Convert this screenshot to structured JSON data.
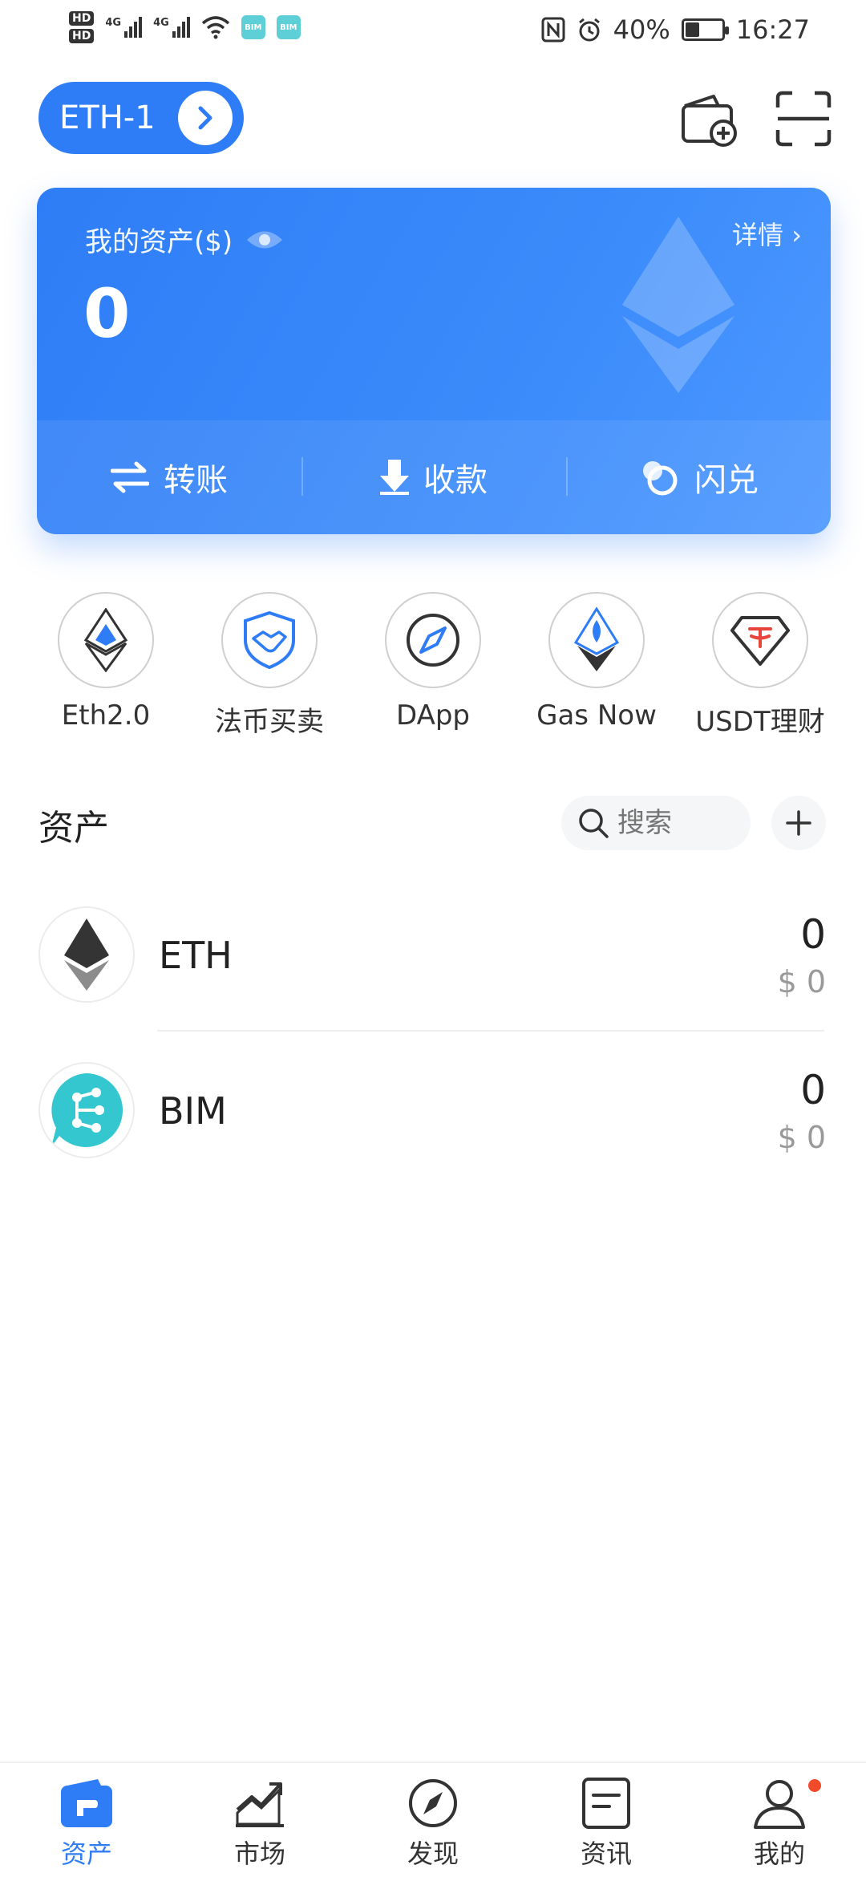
{
  "status_bar": {
    "hd1": "HD",
    "hd2": "HD",
    "net1": "4G",
    "net2": "4G",
    "app_icon_1": "BIM",
    "app_icon_2": "BIM",
    "battery_percent": "40%",
    "battery_level": 0.4,
    "time": "16:27"
  },
  "header": {
    "wallet_name": "ETH-1",
    "icons": [
      "wallet-add-icon",
      "scan-icon"
    ]
  },
  "asset_card": {
    "title": "我的资产($)",
    "total": "0",
    "detail_label": "详情 ›",
    "actions": [
      {
        "label": "转账",
        "icon": "transfer-icon"
      },
      {
        "label": "收款",
        "icon": "receive-icon"
      },
      {
        "label": "闪兑",
        "icon": "swap-icon"
      }
    ]
  },
  "shortcuts": [
    {
      "label": "Eth2.0",
      "icon": "eth2-icon"
    },
    {
      "label": "法币买卖",
      "icon": "handshake-shield-icon"
    },
    {
      "label": "DApp",
      "icon": "compass-icon"
    },
    {
      "label": "Gas Now",
      "icon": "gas-icon"
    },
    {
      "label": "USDT理财",
      "icon": "usdt-diamond-icon"
    }
  ],
  "assets_section": {
    "title": "资产",
    "search_placeholder": "搜索"
  },
  "tokens": [
    {
      "symbol": "ETH",
      "amount": "0",
      "usd": "$ 0"
    },
    {
      "symbol": "BIM",
      "amount": "0",
      "usd": "$ 0"
    }
  ],
  "bottom_nav": [
    {
      "label": "资产",
      "icon": "wallet-icon",
      "active": true
    },
    {
      "label": "市场",
      "icon": "market-chart-icon",
      "active": false
    },
    {
      "label": "发现",
      "icon": "discover-compass-icon",
      "active": false
    },
    {
      "label": "资讯",
      "icon": "news-icon",
      "active": false
    },
    {
      "label": "我的",
      "icon": "profile-icon",
      "active": false
    }
  ],
  "colors": {
    "accent": "#2f7df6",
    "notification_dot": "#f24b2b",
    "bim_teal": "#35c7cf"
  }
}
